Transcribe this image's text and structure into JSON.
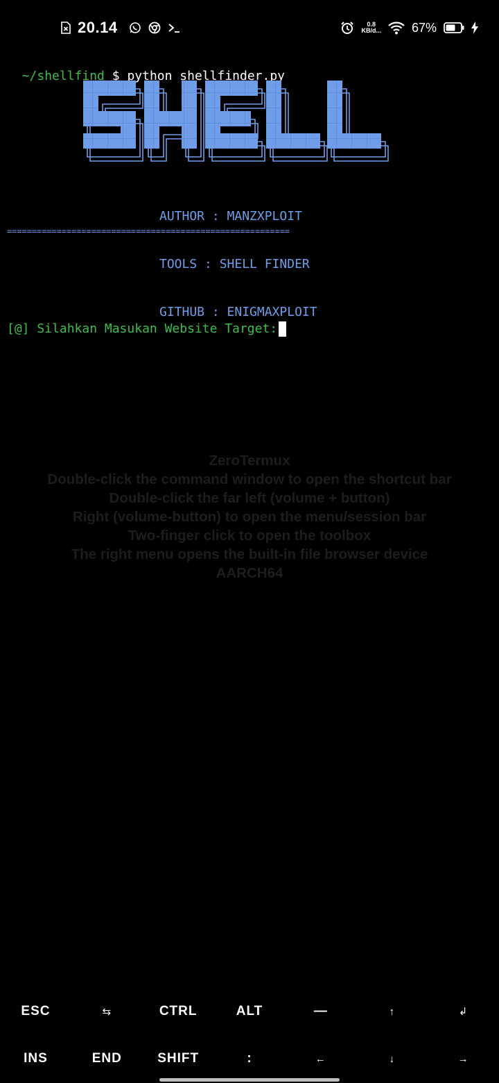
{
  "status_bar": {
    "time": "20.14",
    "net_speed_value": "0.8",
    "net_speed_unit": "KB/d...",
    "battery_percent": "67%",
    "icons": [
      "sim-alert-icon",
      "whatsapp-icon",
      "chrome-icon",
      "terminal-icon",
      "alarm-icon",
      "wifi-icon",
      "battery-icon",
      "charging-icon"
    ]
  },
  "terminal": {
    "cwd": "~/shellfind",
    "prompt_symbol": "$",
    "command": "python shellfinder.py",
    "banner_word": "SHELL",
    "info_lines": [
      "AUTHOR : MANZXPLOIT",
      "TOOLS : SHELL FINDER",
      "GITHUB : ENIGMAXPLOIT"
    ],
    "separator": "=========================================================",
    "input_prompt": "[@] Silahkan Masukan Website Target:"
  },
  "hint_overlay": [
    "ZeroTermux",
    "Double-click the command window to open the shortcut bar",
    "Double-click the far left (volume + button)",
    "Right (volume-button) to open the menu/session bar",
    "Two-finger click to open the toolbox",
    "The right menu opens the built-in file browser device",
    "AARCH64"
  ],
  "extra_keys": {
    "row1": [
      "ESC",
      "⇆",
      "CTRL",
      "ALT",
      "—",
      "↑",
      "↲"
    ],
    "row2": [
      "INS",
      "END",
      "SHIFT",
      ":",
      "←",
      "↓",
      "→"
    ]
  },
  "colors": {
    "background": "#000000",
    "prompt_green": "#3bbf4a",
    "banner_blue": "#6f9de8",
    "hint_text": "#1d1d1d"
  }
}
